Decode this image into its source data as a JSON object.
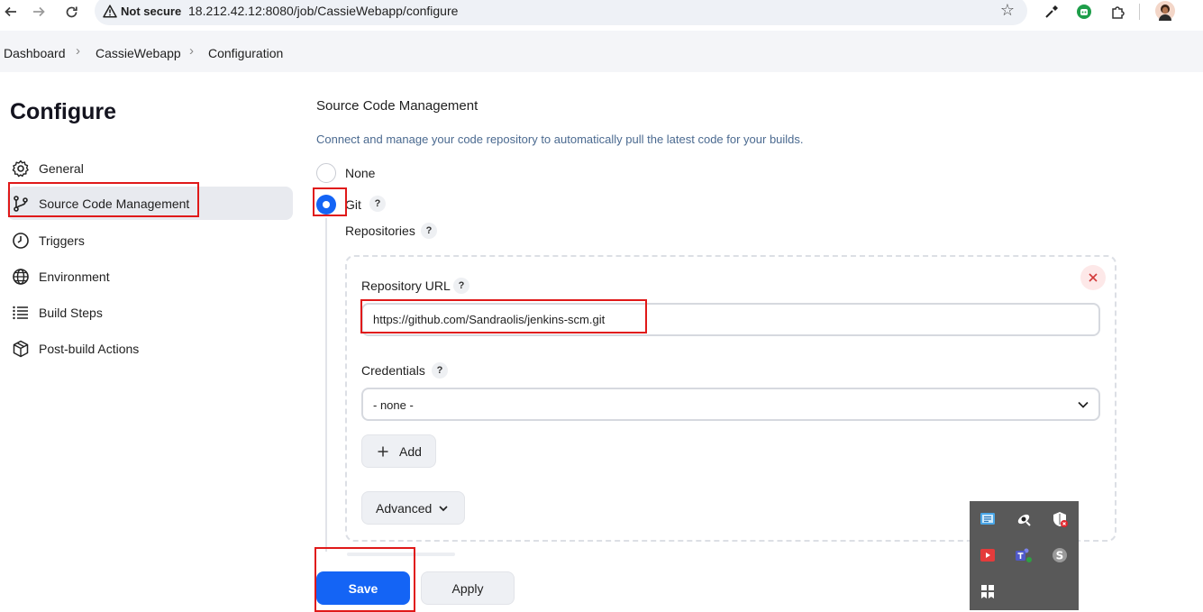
{
  "browser": {
    "security_label": "Not secure",
    "url": "18.212.42.12:8080/job/CassieWebapp/configure",
    "icons": [
      "back-arrow-icon",
      "forward-arrow-icon",
      "reload-icon",
      "warning-icon",
      "star-icon",
      "eyedropper-icon",
      "extension-icon",
      "puzzle-icon",
      "avatar"
    ]
  },
  "breadcrumb": {
    "items": [
      "Dashboard",
      "CassieWebapp",
      "Configuration"
    ]
  },
  "sidebar": {
    "title": "Configure",
    "items": [
      {
        "label": "General",
        "icon": "gear-icon"
      },
      {
        "label": "Source Code Management",
        "icon": "branch-icon",
        "active": true
      },
      {
        "label": "Triggers",
        "icon": "clock-icon"
      },
      {
        "label": "Environment",
        "icon": "globe-icon"
      },
      {
        "label": "Build Steps",
        "icon": "list-icon"
      },
      {
        "label": "Post-build Actions",
        "icon": "package-icon"
      }
    ]
  },
  "scm": {
    "title": "Source Code Management",
    "description": "Connect and manage your code repository to automatically pull the latest code for your builds.",
    "options": [
      {
        "label": "None",
        "selected": false
      },
      {
        "label": "Git",
        "selected": true
      }
    ],
    "help_glyph": "?",
    "repositories_label": "Repositories",
    "repository_url_label": "Repository URL",
    "repository_url_value": "https://github.com/Sandraolis/jenkins-scm.git",
    "credentials_label": "Credentials",
    "credentials_value": "- none -",
    "add_label": "Add",
    "advanced_label": "Advanced"
  },
  "actions": {
    "save_label": "Save",
    "apply_label": "Apply"
  },
  "colors": {
    "accent": "#1464f5",
    "annotation": "#e01919",
    "description_text": "#4b6a90"
  }
}
